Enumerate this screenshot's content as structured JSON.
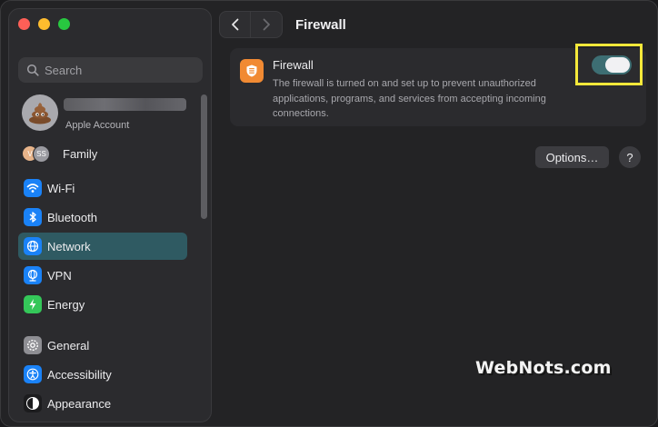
{
  "sidebar": {
    "search": {
      "placeholder": "Search"
    },
    "account": {
      "subtitle": "Apple Account"
    },
    "family": {
      "label": "Family",
      "avatar_a": "V",
      "avatar_b": "SS"
    },
    "items": [
      {
        "label": "Wi-Fi",
        "icon": "wifi-icon",
        "color": "#1a82f7"
      },
      {
        "label": "Bluetooth",
        "icon": "bluetooth-icon",
        "color": "#1a82f7"
      },
      {
        "label": "Network",
        "icon": "globe-icon",
        "color": "#1a82f7",
        "active": true
      },
      {
        "label": "VPN",
        "icon": "vpn-globe-icon",
        "color": "#1a82f7"
      },
      {
        "label": "Energy",
        "icon": "bolt-icon",
        "color": "#34c759"
      },
      {
        "label": "General",
        "icon": "gear-icon",
        "color": "#8e8e93"
      },
      {
        "label": "Accessibility",
        "icon": "accessibility-icon",
        "color": "#1a82f7"
      },
      {
        "label": "Appearance",
        "icon": "appearance-icon",
        "color": "#1c1c1e"
      }
    ]
  },
  "toolbar": {
    "title": "Firewall"
  },
  "firewall_card": {
    "title": "Firewall",
    "description": "The firewall is turned on and set up to prevent unauthorized applications, programs, and services from accepting incoming connections.",
    "enabled": true
  },
  "buttons": {
    "options": "Options…",
    "help": "?"
  },
  "watermark": "WebNots.com",
  "colors": {
    "accent": "#2f5a62",
    "toggle_on": "#3d6e73",
    "highlight": "#f4e83a",
    "firewall_icon": "#f18a33"
  }
}
